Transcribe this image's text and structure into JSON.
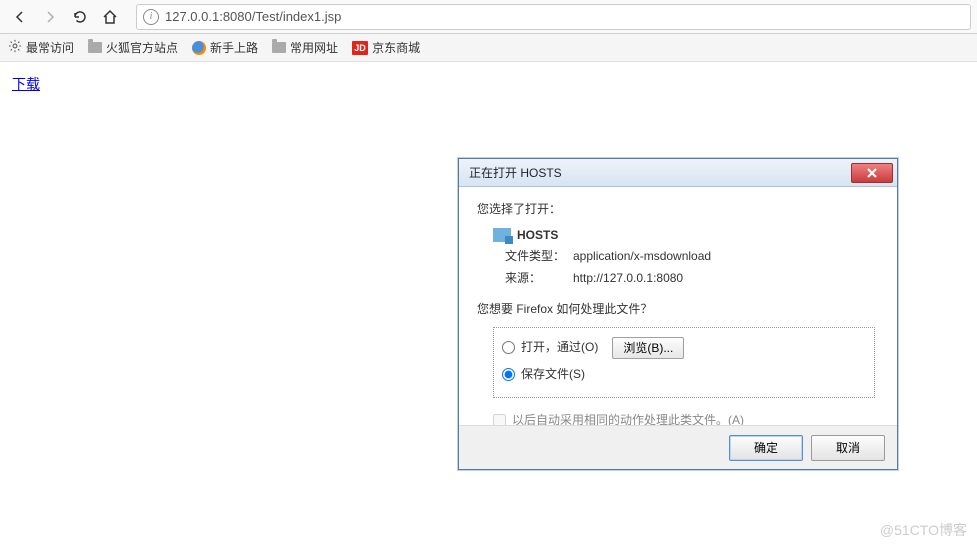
{
  "nav": {
    "url": "127.0.0.1:8080/Test/index1.jsp"
  },
  "bookmarks": {
    "most_visited": "最常访问",
    "firefox_official": "火狐官方站点",
    "getting_started": "新手上路",
    "common_sites": "常用网址",
    "jd_label": "京东商城",
    "jd_badge": "JD"
  },
  "page": {
    "download_link": "下载"
  },
  "dialog": {
    "title": "正在打开 HOSTS",
    "you_selected": "您选择了打开：",
    "file_name": "HOSTS",
    "file_type_label": "文件类型：",
    "file_type_value": "application/x-msdownload",
    "source_label": "来源：",
    "source_value": "http://127.0.0.1:8080",
    "prompt": "您想要 Firefox 如何处理此文件？",
    "open_with": "打开，通过(O)",
    "browse": "浏览(B)...",
    "save_file": "保存文件(S)",
    "remember": "以后自动采用相同的动作处理此类文件。(A)",
    "ok": "确定",
    "cancel": "取消"
  },
  "watermark": "@51CTO博客"
}
